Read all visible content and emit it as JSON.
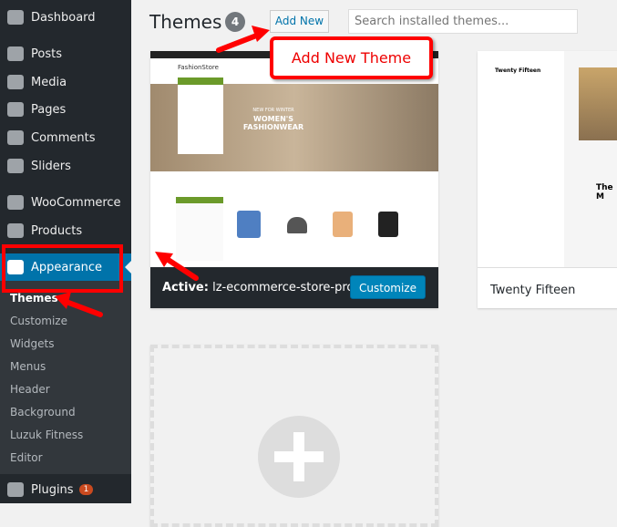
{
  "sidebar": {
    "items": [
      {
        "label": "Dashboard",
        "icon": "dashboard-icon"
      },
      {
        "label": "Posts",
        "icon": "pin-icon"
      },
      {
        "label": "Media",
        "icon": "media-icon"
      },
      {
        "label": "Pages",
        "icon": "pages-icon"
      },
      {
        "label": "Comments",
        "icon": "comment-icon"
      },
      {
        "label": "Sliders",
        "icon": "sliders-icon"
      },
      {
        "label": "WooCommerce",
        "icon": "woo-icon"
      },
      {
        "label": "Products",
        "icon": "box-icon"
      },
      {
        "label": "Appearance",
        "icon": "brush-icon"
      },
      {
        "label": "Plugins",
        "icon": "plug-icon",
        "badge": "1"
      }
    ],
    "submenu": [
      "Themes",
      "Customize",
      "Widgets",
      "Menus",
      "Header",
      "Background",
      "Luzuk Fitness",
      "Editor"
    ]
  },
  "header": {
    "title": "Themes",
    "count": "4",
    "add_new": "Add New",
    "search_placeholder": "Search installed themes..."
  },
  "annotation": {
    "callout": "Add New Theme",
    "color": "#ff0000"
  },
  "themes": [
    {
      "active_label": "Active:",
      "name": "lz-ecommerce-store-pro",
      "customize": "Customize",
      "preview": {
        "brand": "FashionStore",
        "banner_sub": "NEW FOR WINTER",
        "banner": "WOMEN'S FASHIONWEAR"
      }
    },
    {
      "name": "Twenty Fifteen",
      "preview": {
        "title": "Twenty Fifteen",
        "heading": "The M"
      }
    }
  ],
  "colors": {
    "sidebar": "#23282d",
    "accent": "#0073aa",
    "brand_green": "#6b9a2a"
  }
}
